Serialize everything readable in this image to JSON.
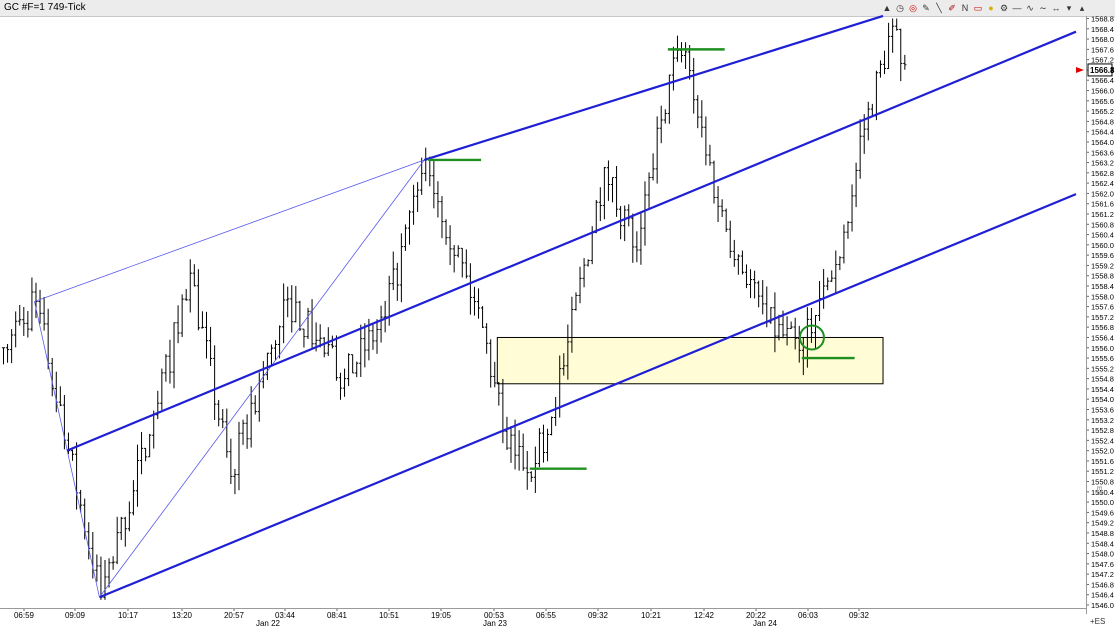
{
  "window": {
    "title": "GC #F=1 749-Tick",
    "toolbar_icons": [
      "chart-type-icon",
      "clock-icon",
      "target-icon",
      "pencil-icon",
      "line-icon",
      "pen-icon",
      "n-icon",
      "rectangle-icon",
      "lightbulb-icon",
      "settings-icon",
      "minus-icon",
      "wave-icon",
      "tilde-icon",
      "arrows-icon",
      "arrow-down-icon",
      "arrow-up-icon"
    ],
    "n_glyph": "N"
  },
  "colors": {
    "background": "#ffffff",
    "bars": "#000000",
    "channel": "#1f1fd6",
    "pitchfork_thin": "#5a5af0",
    "level_marks": "#1f8f1f",
    "zone_fill": "#fffcd6",
    "price_marker": "#e00000"
  },
  "chart_data": {
    "type": "ohlc",
    "symbol": "GC #F=1 749-Tick",
    "y_axis": {
      "min": 1546.0,
      "max": 1568.8,
      "step": 0.4,
      "side": "right",
      "tick_labels": [
        "1568.8",
        "1568.4",
        "1568.0",
        "1567.6",
        "1567.2",
        "1566.8",
        "1566.4",
        "1566.0",
        "1565.6",
        "1565.2",
        "1564.8",
        "1564.4",
        "1564.0",
        "1563.6",
        "1563.2",
        "1562.8",
        "1562.4",
        "1562.0",
        "1561.6",
        "1561.2",
        "1560.8",
        "1560.4",
        "1560.0",
        "1559.6",
        "1559.2",
        "1558.8",
        "1558.4",
        "1558.0",
        "1557.6",
        "1557.2",
        "1556.8",
        "1556.4",
        "1556.0",
        "1555.6",
        "1555.2",
        "1554.8",
        "1554.4",
        "1554.0",
        "1553.6",
        "1553.2",
        "1552.8",
        "1552.4",
        "1552.0",
        "1551.6",
        "1551.2",
        "1550.8",
        "1550.4",
        "1550.0",
        "1549.6",
        "1549.2",
        "1548.8",
        "1548.4",
        "1548.0",
        "1547.6",
        "1547.2",
        "1546.8",
        "1546.4",
        "1546.0"
      ]
    },
    "current_price_label": "1566.8",
    "current_price": 1566.8,
    "x_axis": {
      "time_labels": [
        "06:59",
        "09:09",
        "10:17",
        "13:20",
        "20:57",
        "03:44",
        "08:41",
        "10:51",
        "19:05",
        "00:53",
        "06:55",
        "09:32",
        "10:21",
        "12:42",
        "20:22",
        "06:03",
        "09:32"
      ],
      "date_labels": [
        "Jan 22",
        "Jan 23",
        "Jan 24"
      ]
    },
    "anchor_points": [
      {
        "bar": 0,
        "price": 1556.0
      },
      {
        "bar": 8,
        "price": 1557.8
      },
      {
        "bar": 16,
        "price": 1552.0
      },
      {
        "bar": 24,
        "price": 1546.3
      },
      {
        "bar": 36,
        "price": 1552.6
      },
      {
        "bar": 46,
        "price": 1558.9
      },
      {
        "bar": 56,
        "price": 1551.0
      },
      {
        "bar": 70,
        "price": 1557.9
      },
      {
        "bar": 84,
        "price": 1554.8
      },
      {
        "bar": 94,
        "price": 1557.2
      },
      {
        "bar": 104,
        "price": 1563.3
      },
      {
        "bar": 118,
        "price": 1556.8
      },
      {
        "bar": 124,
        "price": 1552.1
      },
      {
        "bar": 131,
        "price": 1551.5
      },
      {
        "bar": 138,
        "price": 1555.3
      },
      {
        "bar": 148,
        "price": 1563.0
      },
      {
        "bar": 156,
        "price": 1559.8
      },
      {
        "bar": 164,
        "price": 1566.6
      },
      {
        "bar": 168,
        "price": 1567.5
      },
      {
        "bar": 176,
        "price": 1561.5
      },
      {
        "bar": 188,
        "price": 1557.0
      },
      {
        "bar": 196,
        "price": 1555.9
      },
      {
        "bar": 206,
        "price": 1559.5
      },
      {
        "bar": 212,
        "price": 1564.5
      },
      {
        "bar": 219,
        "price": 1568.5
      },
      {
        "bar": 222,
        "price": 1567.0
      }
    ],
    "bar_count": 223,
    "channel_lines": [
      {
        "name": "upper",
        "from": {
          "bar": 104,
          "price": 1563.3
        },
        "to": {
          "bar": 217,
          "price": 1568.9
        }
      },
      {
        "name": "middle",
        "from": {
          "bar": 16,
          "price": 1552.0
        },
        "to": {
          "bar": 222,
          "price": 1565.5
        }
      },
      {
        "name": "lower",
        "from": {
          "bar": 24,
          "price": 1546.3
        },
        "to": {
          "bar": 222,
          "price": 1559.2
        }
      }
    ],
    "pitchfork_lines": [
      {
        "from": {
          "bar": 8,
          "price": 1557.8
        },
        "to": {
          "bar": 104,
          "price": 1563.3
        }
      },
      {
        "from": {
          "bar": 24,
          "price": 1546.3
        },
        "to": {
          "bar": 104,
          "price": 1563.3
        }
      },
      {
        "from": {
          "bar": 8,
          "price": 1557.8
        },
        "to": {
          "bar": 24,
          "price": 1546.3
        }
      }
    ],
    "level_marks": [
      {
        "from_bar": 105,
        "to_bar": 118,
        "price": 1563.3
      },
      {
        "from_bar": 164,
        "to_bar": 178,
        "price": 1567.6
      },
      {
        "from_bar": 130,
        "to_bar": 144,
        "price": 1551.3
      },
      {
        "from_bar": 197,
        "to_bar": 210,
        "price": 1555.6
      }
    ],
    "circle_marker": {
      "bar": 199,
      "price": 1556.4
    },
    "zone": {
      "from_bar": 122,
      "to_bar": 217,
      "price_top": 1556.4,
      "price_bottom": 1554.6
    }
  },
  "corner_label": "+ES",
  "scale_label": "ES"
}
